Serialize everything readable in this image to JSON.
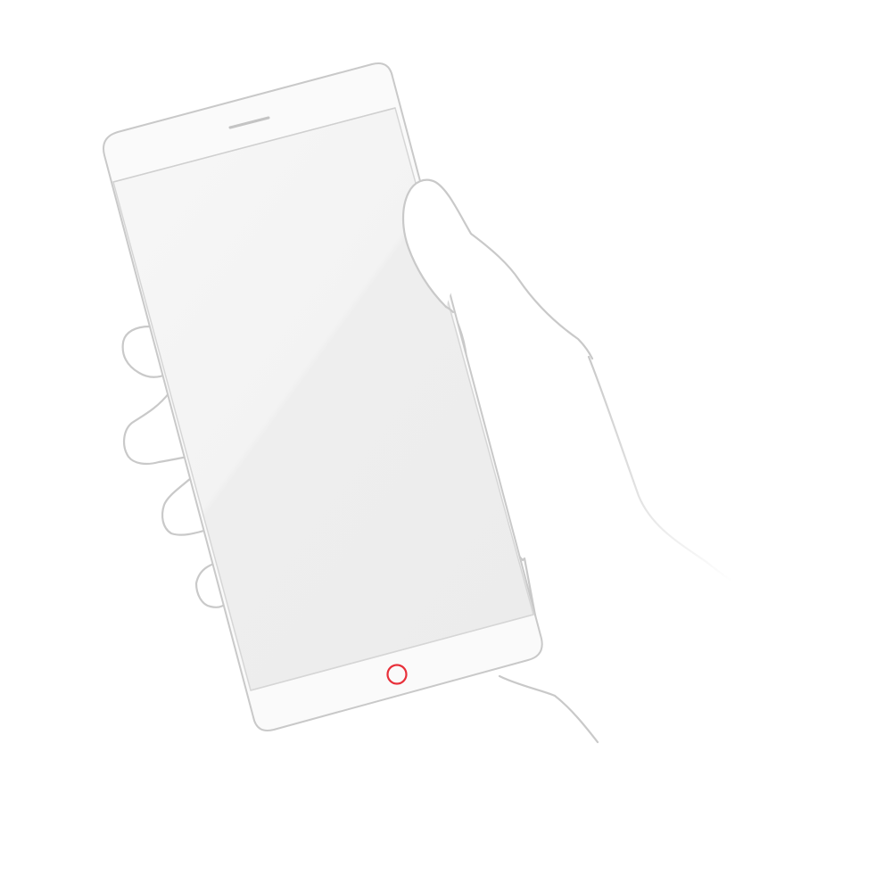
{
  "colors": {
    "background": "#ffffff",
    "outline": "#c9c9c9",
    "phone_body": "#fafafa",
    "screen_fill": "#efefef",
    "home_button": "#e8303a"
  },
  "icons": {
    "home_button": "circle-icon"
  }
}
